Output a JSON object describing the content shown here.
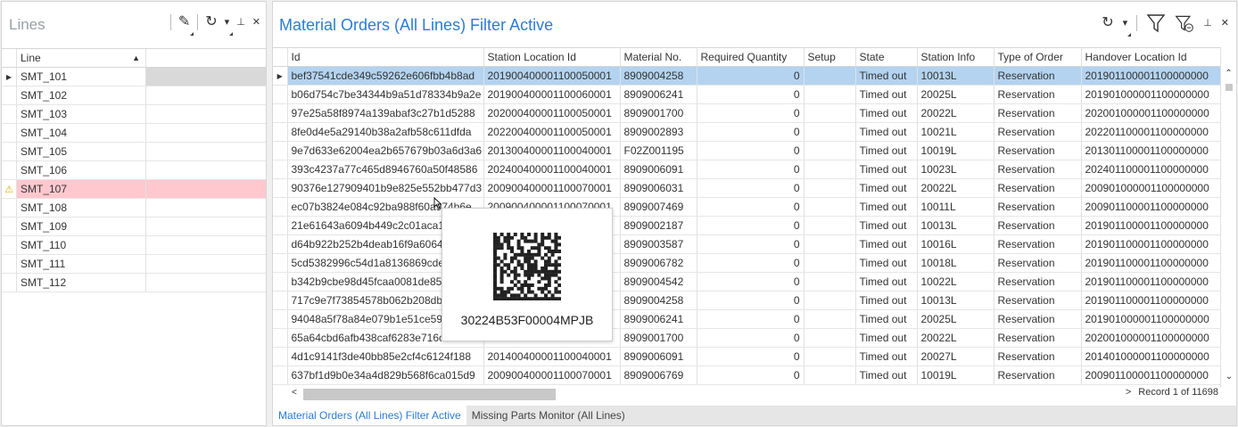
{
  "left": {
    "title": "Lines",
    "column_header": "Line",
    "lines": [
      "SMT_101",
      "SMT_102",
      "SMT_103",
      "SMT_104",
      "SMT_105",
      "SMT_106",
      "SMT_107",
      "SMT_108",
      "SMT_109",
      "SMT_110",
      "SMT_111",
      "SMT_112"
    ],
    "selected_line": "SMT_101",
    "warning_line": "SMT_107"
  },
  "right": {
    "title": "Material Orders (All Lines) Filter Active",
    "columns": [
      "Id",
      "Station Location Id",
      "Material No.",
      "Required Quantity",
      "Setup",
      "State",
      "Station Info",
      "Type of Order",
      "Handover Location Id"
    ],
    "rows": [
      [
        "bef37541cde349c59262e606fbb4b8ad",
        "20190040000110005000​1",
        "8909004258",
        "0",
        "",
        "Timed out",
        "10013L",
        "Reservation",
        "20190110000110000000​0"
      ],
      [
        "b06d754c7be34344b9a51d78334b9a2e",
        "201900400001100060001",
        "8909006241",
        "0",
        "",
        "Timed out",
        "20025L",
        "Reservation",
        "201901000001100000000"
      ],
      [
        "97e25a58f8974a139abaf3c27b1d5288",
        "202000400001100050001",
        "8909001700",
        "0",
        "",
        "Timed out",
        "20022L",
        "Reservation",
        "202001000001100000000"
      ],
      [
        "8fe0d4e5a29140b38a2afb58c611dfda",
        "202200400001100050001",
        "8909002893",
        "0",
        "",
        "Timed out",
        "10021L",
        "Reservation",
        "202201100001100000000"
      ],
      [
        "9e7d633e62004ea2b657679b03a6d3a6",
        "201300400001100040001",
        "F02Z001195",
        "0",
        "",
        "Timed out",
        "10019L",
        "Reservation",
        "201301100001100000000"
      ],
      [
        "393c4237a77c465d8946760a50f48586",
        "202400400001100040001",
        "8909006091",
        "0",
        "",
        "Timed out",
        "10023L",
        "Reservation",
        "202401100001100000000"
      ],
      [
        "90376e127909401b9e825e552bb477d3",
        "200900400001100070001",
        "8909006031",
        "0",
        "",
        "Timed out",
        "20022L",
        "Reservation",
        "200901000001100000000"
      ],
      [
        "ec07b3824e084c92ba988f60a974b6e",
        "200900400001100070001",
        "8909007469",
        "0",
        "",
        "Timed out",
        "10011L",
        "Reservation",
        "200901100001100000000"
      ],
      [
        "21e61643a6094b449c2c01aca18",
        "",
        "8909002187",
        "0",
        "",
        "Timed out",
        "10013L",
        "Reservation",
        "201901100001100000000"
      ],
      [
        "d64b922b252b4deab16f9a6064",
        "",
        "8909003587",
        "0",
        "",
        "Timed out",
        "10016L",
        "Reservation",
        "201901100001100000000"
      ],
      [
        "5cd5382996c54d1a8136869cde",
        "",
        "8909006782",
        "0",
        "",
        "Timed out",
        "10018L",
        "Reservation",
        "201901100001100000000"
      ],
      [
        "b342b9cbe98d45fcaa0081de85b",
        "",
        "8909004542",
        "0",
        "",
        "Timed out",
        "10022L",
        "Reservation",
        "201901100001100000000"
      ],
      [
        "717c9e7f73854578b062b208db9",
        "",
        "8909004258",
        "0",
        "",
        "Timed out",
        "10013L",
        "Reservation",
        "201901100001100000000"
      ],
      [
        "94048a5f78a84e079b1e51ce59c",
        "",
        "8909006241",
        "0",
        "",
        "Timed out",
        "20025L",
        "Reservation",
        "201901000001100000000"
      ],
      [
        "65a64cbd6afb438caf6283e716c",
        "",
        "8909001700",
        "0",
        "",
        "Timed out",
        "20022L",
        "Reservation",
        "202001000001100000000"
      ],
      [
        "4d1c9141f3de40bb85e2cf4c6124f188",
        "201400400001100040001",
        "8909006091",
        "0",
        "",
        "Timed out",
        "20027L",
        "Reservation",
        "201401000001100000000"
      ],
      [
        "637bf1d9b0e34a4d829b568f6ca015d9",
        "200900400001100070001",
        "8909006769",
        "0",
        "",
        "Timed out",
        "10019L",
        "Reservation",
        "200901100001100000000"
      ]
    ],
    "record_info": "Record 1 of 11698"
  },
  "tabs": [
    "Material Orders (All Lines) Filter Active",
    "Missing Parts Monitor (All Lines)"
  ],
  "popup": {
    "code_text": "30224B53F00004MPJB"
  },
  "colors": {
    "accent": "#2b7cd3",
    "selected_row": "#b3d3f0",
    "warning_row": "#ffc8ce"
  }
}
